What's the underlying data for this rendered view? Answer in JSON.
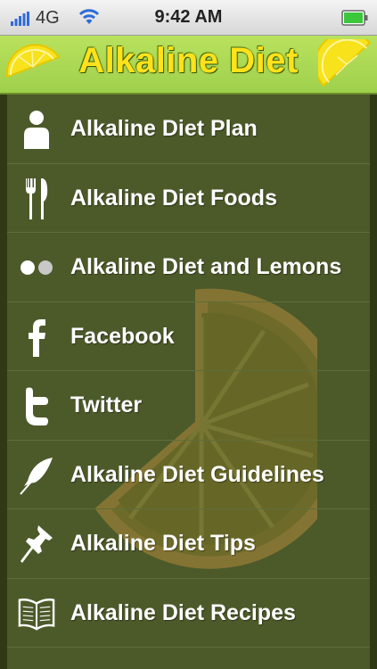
{
  "status_bar": {
    "network": "4G",
    "time": "9:42 AM"
  },
  "header": {
    "title": "Alkaline Diet"
  },
  "menu": {
    "items": [
      {
        "label": "Alkaline Diet Plan",
        "icon": "person-icon"
      },
      {
        "label": "Alkaline Diet Foods",
        "icon": "fork-knife-icon"
      },
      {
        "label": "Alkaline Diet and Lemons",
        "icon": "dots-icon"
      },
      {
        "label": "Facebook",
        "icon": "facebook-icon"
      },
      {
        "label": "Twitter",
        "icon": "twitter-icon"
      },
      {
        "label": "Alkaline Diet Guidelines",
        "icon": "feather-icon"
      },
      {
        "label": "Alkaline Diet Tips",
        "icon": "pushpin-icon"
      },
      {
        "label": "Alkaline Diet Recipes",
        "icon": "book-icon"
      }
    ]
  },
  "colors": {
    "header_background": "#a8d552",
    "title": "#ffe21a",
    "content_background": "#4c5a2a",
    "menu_text": "#ffffff"
  }
}
